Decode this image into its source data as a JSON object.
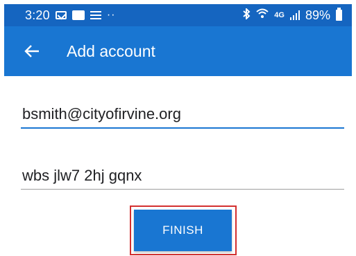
{
  "status_bar": {
    "time": "3:20",
    "dots": "··",
    "network_label": "4G",
    "battery_percent": "89%",
    "left_icons": [
      "mail-icon",
      "message-icon",
      "notes-icon"
    ],
    "right_icons": [
      "bluetooth-icon",
      "wifi-icon",
      "signal-icon",
      "battery-icon"
    ]
  },
  "app_bar": {
    "title": "Add account",
    "back_icon": "arrow-left-icon"
  },
  "form": {
    "email_value": "bsmith@cityofirvine.org",
    "password_value": "wbs jlw7 2hj gqnx"
  },
  "actions": {
    "finish_label": "FINISH"
  },
  "colors": {
    "status_bar": "#1565c0",
    "app_bar": "#1976d2",
    "button": "#1976d2",
    "highlight": "#d32f2f"
  }
}
